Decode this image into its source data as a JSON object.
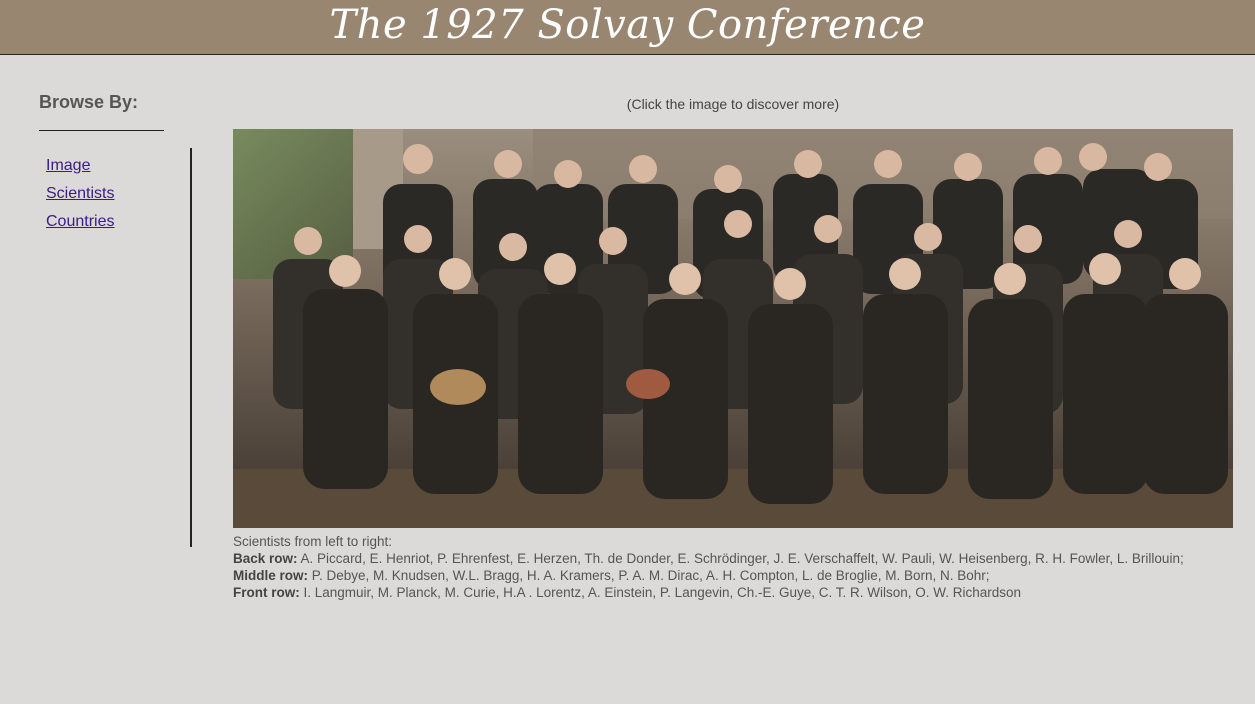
{
  "header": {
    "title": "The 1927 Solvay Conference"
  },
  "sidebar": {
    "heading": "Browse By:",
    "items": [
      {
        "label": "Image"
      },
      {
        "label": "Scientists"
      },
      {
        "label": "Countries"
      }
    ]
  },
  "main": {
    "hint": "(Click the image to discover more)",
    "image_icon": "group-photo-icon",
    "caption": {
      "intro": "Scientists from left to right:",
      "back_label": "Back row:",
      "back_text": "A. Piccard, E. Henriot, P. Ehrenfest, E. Herzen, Th. de Donder, E. Schrödinger, J. E. Verschaffelt, W. Pauli, W. Heisenberg, R. H. Fowler, L. Brillouin;",
      "middle_label": "Middle row:",
      "middle_text": "P. Debye, M. Knudsen, W.L. Bragg, H. A. Kramers, P. A. M. Dirac, A. H. Compton, L. de Broglie, M. Born, N. Bohr;",
      "front_label": "Front row:",
      "front_text": "I. Langmuir, M. Planck, M. Curie, H.A . Lorentz, A. Einstein, P. Langevin, Ch.-E. Guye, C. T. R. Wilson, O. W. Richardson"
    }
  },
  "colors": {
    "header_bg": "#998670",
    "page_bg": "#dcdad8",
    "link": "#3b1a8c"
  }
}
